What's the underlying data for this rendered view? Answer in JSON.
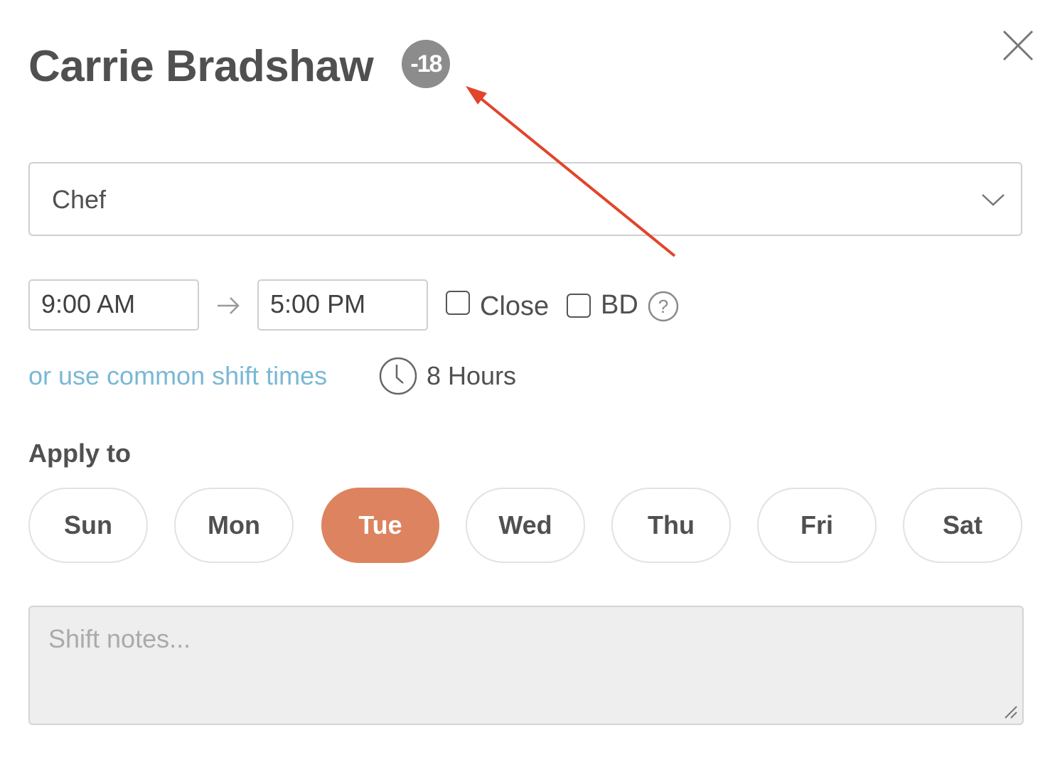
{
  "header": {
    "employee_name": "Carrie Bradshaw",
    "age_badge": "-18"
  },
  "close_icon": "close-icon",
  "role": {
    "selected": "Chef"
  },
  "shift": {
    "start_time": "9:00 AM",
    "end_time": "5:00 PM",
    "close_label": "Close",
    "close_checked": false,
    "bd_label": "BD",
    "bd_checked": false,
    "common_times_link": "or use common shift times",
    "duration": "8 Hours"
  },
  "apply_to": {
    "label": "Apply to",
    "days": [
      {
        "label": "Sun",
        "active": false
      },
      {
        "label": "Mon",
        "active": false
      },
      {
        "label": "Tue",
        "active": true
      },
      {
        "label": "Wed",
        "active": false
      },
      {
        "label": "Thu",
        "active": false
      },
      {
        "label": "Fri",
        "active": false
      },
      {
        "label": "Sat",
        "active": false
      }
    ]
  },
  "notes": {
    "placeholder": "Shift notes..."
  },
  "colors": {
    "accent": "#dd835f",
    "link": "#7ab8d6",
    "badge": "#8c8c8c",
    "annotation_arrow": "#e2442c"
  }
}
